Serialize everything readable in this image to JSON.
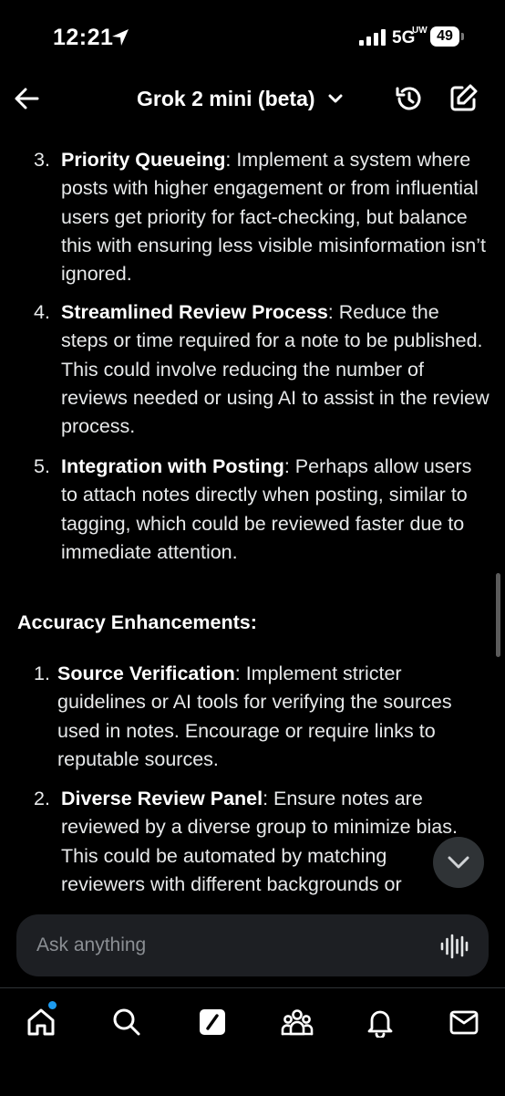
{
  "status_bar": {
    "time": "12:21",
    "network": "5G",
    "network_sub": "UW",
    "battery": "49"
  },
  "header": {
    "title": "Grok 2 mini (beta)",
    "icons": [
      "back-arrow-icon",
      "chevron-down-icon",
      "history-icon",
      "compose-icon"
    ]
  },
  "content": {
    "list_a": [
      {
        "num": "3.",
        "title": "Priority Queueing",
        "text": ": Implement a system where posts with higher engagement or from influential users get priority for fact-checking, but balance this with ensuring less visible misinformation isn’t ignored."
      },
      {
        "num": "4.",
        "title": "Streamlined Review Process",
        "text": ": Reduce the steps or time required for a note to be published. This could involve reducing the number of reviews needed or using AI to assist in the review process."
      },
      {
        "num": "5.",
        "title": "Integration with Posting",
        "text": ": Perhaps allow users to attach notes directly when posting, similar to tagging, which could be reviewed faster due to immediate attention."
      }
    ],
    "section_heading": "Accuracy Enhancements:",
    "list_b": [
      {
        "num": "1.",
        "title": "Source Verification",
        "text": ": Implement stricter guidelines or AI tools for verifying the sources used in notes. Encourage or require links to reputable sources."
      },
      {
        "num": "2.",
        "title": "Diverse Review Panel",
        "text": ": Ensure notes are reviewed by a diverse group to minimize bias. This could be automated by matching reviewers with different backgrounds or"
      }
    ]
  },
  "input": {
    "placeholder": "Ask anything"
  },
  "bottom_nav": {
    "items": [
      "home-icon",
      "search-icon",
      "grok-icon",
      "communities-icon",
      "notifications-icon",
      "messages-icon"
    ]
  },
  "colors": {
    "background": "#000000",
    "text": "#e7e9ea",
    "input_bg": "#1d1f23",
    "accent": "#1d9bf0"
  }
}
